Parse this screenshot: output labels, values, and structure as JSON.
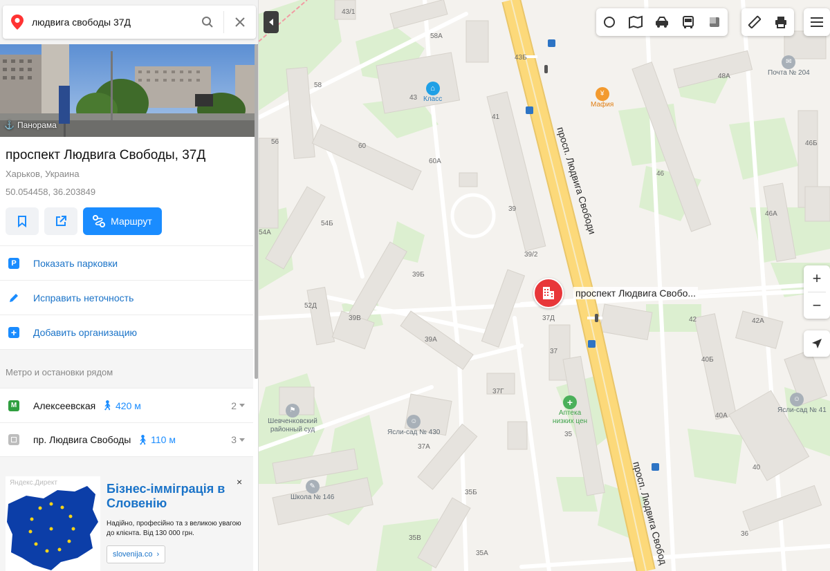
{
  "search": {
    "value": "людвига свободы 37Д",
    "placeholder": ""
  },
  "panorama": {
    "badge": "Панорама"
  },
  "card": {
    "title": "проспект Людвига Свободы, 37Д",
    "subtitle": "Харьков, Украина",
    "coords": "50.054458, 36.203849",
    "route_label": "Маршрут"
  },
  "actions": [
    {
      "label": "Показать парковки",
      "icon": "parking-icon"
    },
    {
      "label": "Исправить неточность",
      "icon": "pencil-icon"
    },
    {
      "label": "Добавить организацию",
      "icon": "plus-icon"
    }
  ],
  "transit": {
    "heading": "Метро и остановки рядом",
    "items": [
      {
        "name": "Алексеевская",
        "distance": "420 м",
        "count": "2",
        "type": "metro",
        "badge": "М",
        "color": "#2f9e3f"
      },
      {
        "name": "пр. Людвига Свободы",
        "distance": "110 м",
        "count": "3",
        "type": "bus-stop",
        "badge": "",
        "color": "#bdbdbd"
      }
    ]
  },
  "ad": {
    "source": "Яндекс.Директ",
    "title": "Бізнес-імміграція в Словенію",
    "text": "Надійно, професійно та з великою увагою до клієнта. Від 130 000 грн.",
    "link": "slovenija.co",
    "close": "×"
  },
  "map": {
    "marker_label": "проспект Людвига Свобо...",
    "marker_house": "37Д",
    "street_labels": [
      "просп. Людвига Свободи",
      "просп. Людвига Свобод"
    ],
    "pois": [
      {
        "name": "Класс",
        "house": "43"
      },
      {
        "name": "Мафия"
      },
      {
        "name": "Почта № 204"
      },
      {
        "name": "Аптека низких цен"
      },
      {
        "name": "Ясли-сад № 430"
      },
      {
        "name": "Ясли-сад № 41"
      },
      {
        "name": "Шевченковский районный суд"
      },
      {
        "name": "Школа № 146"
      }
    ],
    "house_numbers": [
      "43/1",
      "58А",
      "43Б",
      "48А",
      "58",
      "41",
      "56",
      "60",
      "60А",
      "46",
      "46Б",
      "39",
      "54Б",
      "54А",
      "46А",
      "39/2",
      "39Б",
      "52Д",
      "39В",
      "39А",
      "42",
      "42А",
      "40Б",
      "37",
      "37Г",
      "37А",
      "40А",
      "35",
      "40",
      "35Б",
      "35В",
      "35А",
      "36",
      "37Д"
    ],
    "zoom_in": "+",
    "zoom_out": "−"
  },
  "colors": {
    "accent": "#1a8cff",
    "marker": "#e8373a",
    "road_main": "#fcd97a",
    "green": "#d7edc9",
    "building": "#e3e0db"
  }
}
